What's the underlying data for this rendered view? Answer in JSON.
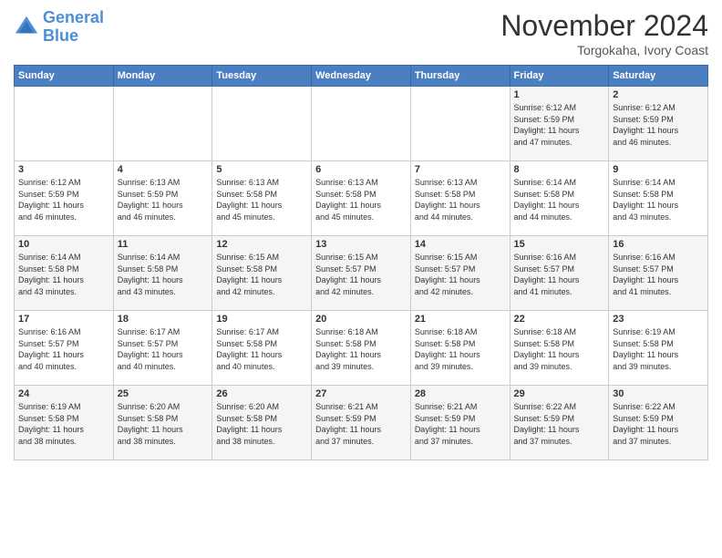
{
  "logo": {
    "line1": "General",
    "line2": "Blue"
  },
  "header": {
    "month_title": "November 2024",
    "subtitle": "Torgokaha, Ivory Coast"
  },
  "weekdays": [
    "Sunday",
    "Monday",
    "Tuesday",
    "Wednesday",
    "Thursday",
    "Friday",
    "Saturday"
  ],
  "weeks": [
    [
      {
        "day": "",
        "info": ""
      },
      {
        "day": "",
        "info": ""
      },
      {
        "day": "",
        "info": ""
      },
      {
        "day": "",
        "info": ""
      },
      {
        "day": "",
        "info": ""
      },
      {
        "day": "1",
        "info": "Sunrise: 6:12 AM\nSunset: 5:59 PM\nDaylight: 11 hours\nand 47 minutes."
      },
      {
        "day": "2",
        "info": "Sunrise: 6:12 AM\nSunset: 5:59 PM\nDaylight: 11 hours\nand 46 minutes."
      }
    ],
    [
      {
        "day": "3",
        "info": "Sunrise: 6:12 AM\nSunset: 5:59 PM\nDaylight: 11 hours\nand 46 minutes."
      },
      {
        "day": "4",
        "info": "Sunrise: 6:13 AM\nSunset: 5:59 PM\nDaylight: 11 hours\nand 46 minutes."
      },
      {
        "day": "5",
        "info": "Sunrise: 6:13 AM\nSunset: 5:58 PM\nDaylight: 11 hours\nand 45 minutes."
      },
      {
        "day": "6",
        "info": "Sunrise: 6:13 AM\nSunset: 5:58 PM\nDaylight: 11 hours\nand 45 minutes."
      },
      {
        "day": "7",
        "info": "Sunrise: 6:13 AM\nSunset: 5:58 PM\nDaylight: 11 hours\nand 44 minutes."
      },
      {
        "day": "8",
        "info": "Sunrise: 6:14 AM\nSunset: 5:58 PM\nDaylight: 11 hours\nand 44 minutes."
      },
      {
        "day": "9",
        "info": "Sunrise: 6:14 AM\nSunset: 5:58 PM\nDaylight: 11 hours\nand 43 minutes."
      }
    ],
    [
      {
        "day": "10",
        "info": "Sunrise: 6:14 AM\nSunset: 5:58 PM\nDaylight: 11 hours\nand 43 minutes."
      },
      {
        "day": "11",
        "info": "Sunrise: 6:14 AM\nSunset: 5:58 PM\nDaylight: 11 hours\nand 43 minutes."
      },
      {
        "day": "12",
        "info": "Sunrise: 6:15 AM\nSunset: 5:58 PM\nDaylight: 11 hours\nand 42 minutes."
      },
      {
        "day": "13",
        "info": "Sunrise: 6:15 AM\nSunset: 5:57 PM\nDaylight: 11 hours\nand 42 minutes."
      },
      {
        "day": "14",
        "info": "Sunrise: 6:15 AM\nSunset: 5:57 PM\nDaylight: 11 hours\nand 42 minutes."
      },
      {
        "day": "15",
        "info": "Sunrise: 6:16 AM\nSunset: 5:57 PM\nDaylight: 11 hours\nand 41 minutes."
      },
      {
        "day": "16",
        "info": "Sunrise: 6:16 AM\nSunset: 5:57 PM\nDaylight: 11 hours\nand 41 minutes."
      }
    ],
    [
      {
        "day": "17",
        "info": "Sunrise: 6:16 AM\nSunset: 5:57 PM\nDaylight: 11 hours\nand 40 minutes."
      },
      {
        "day": "18",
        "info": "Sunrise: 6:17 AM\nSunset: 5:57 PM\nDaylight: 11 hours\nand 40 minutes."
      },
      {
        "day": "19",
        "info": "Sunrise: 6:17 AM\nSunset: 5:58 PM\nDaylight: 11 hours\nand 40 minutes."
      },
      {
        "day": "20",
        "info": "Sunrise: 6:18 AM\nSunset: 5:58 PM\nDaylight: 11 hours\nand 39 minutes."
      },
      {
        "day": "21",
        "info": "Sunrise: 6:18 AM\nSunset: 5:58 PM\nDaylight: 11 hours\nand 39 minutes."
      },
      {
        "day": "22",
        "info": "Sunrise: 6:18 AM\nSunset: 5:58 PM\nDaylight: 11 hours\nand 39 minutes."
      },
      {
        "day": "23",
        "info": "Sunrise: 6:19 AM\nSunset: 5:58 PM\nDaylight: 11 hours\nand 39 minutes."
      }
    ],
    [
      {
        "day": "24",
        "info": "Sunrise: 6:19 AM\nSunset: 5:58 PM\nDaylight: 11 hours\nand 38 minutes."
      },
      {
        "day": "25",
        "info": "Sunrise: 6:20 AM\nSunset: 5:58 PM\nDaylight: 11 hours\nand 38 minutes."
      },
      {
        "day": "26",
        "info": "Sunrise: 6:20 AM\nSunset: 5:58 PM\nDaylight: 11 hours\nand 38 minutes."
      },
      {
        "day": "27",
        "info": "Sunrise: 6:21 AM\nSunset: 5:59 PM\nDaylight: 11 hours\nand 37 minutes."
      },
      {
        "day": "28",
        "info": "Sunrise: 6:21 AM\nSunset: 5:59 PM\nDaylight: 11 hours\nand 37 minutes."
      },
      {
        "day": "29",
        "info": "Sunrise: 6:22 AM\nSunset: 5:59 PM\nDaylight: 11 hours\nand 37 minutes."
      },
      {
        "day": "30",
        "info": "Sunrise: 6:22 AM\nSunset: 5:59 PM\nDaylight: 11 hours\nand 37 minutes."
      }
    ]
  ]
}
